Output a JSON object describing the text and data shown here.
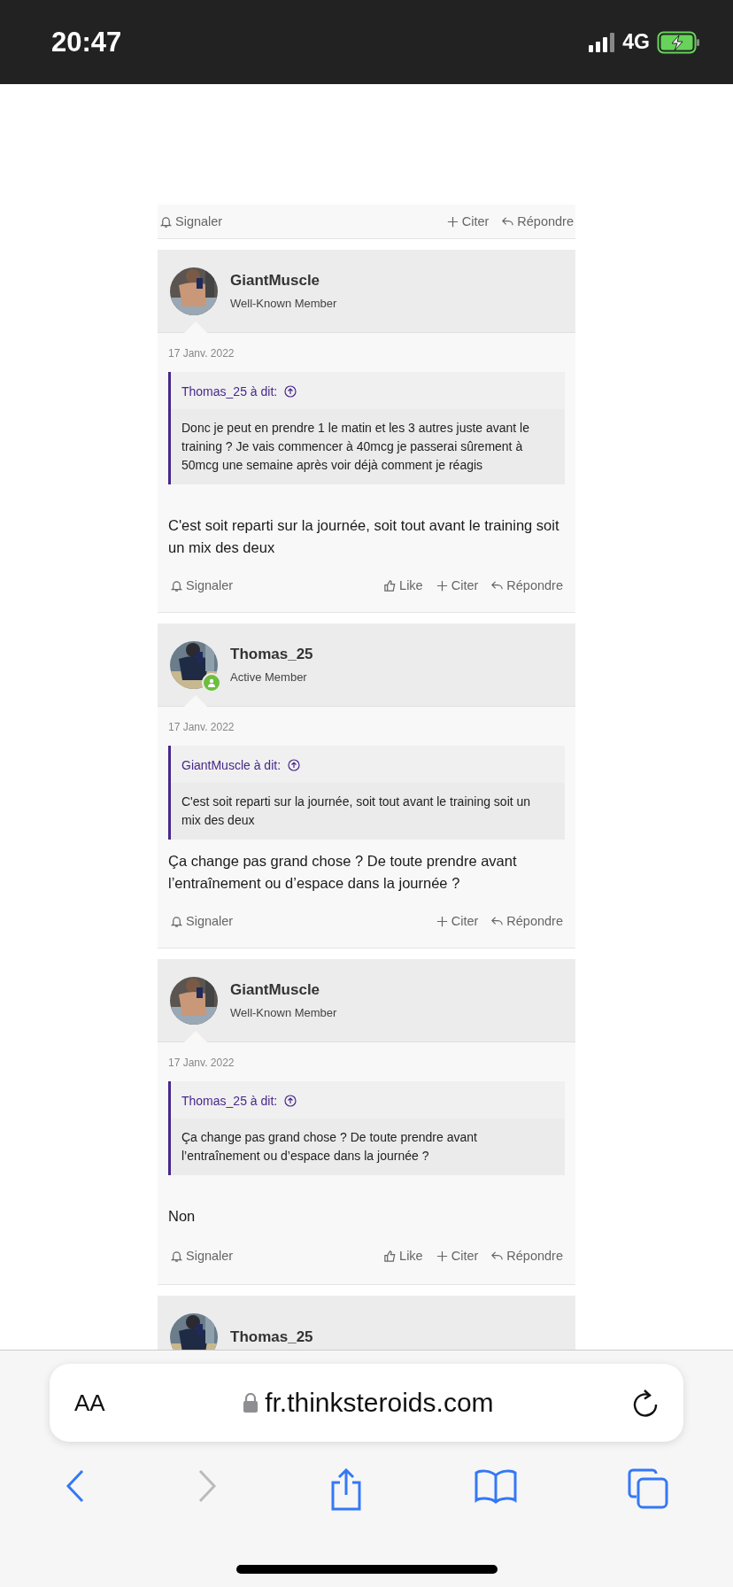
{
  "status_bar": {
    "time": "20:47",
    "network": "4G"
  },
  "previous_footer": {
    "actions": [
      {
        "kind": "report",
        "label": "Signaler"
      },
      {
        "kind": "quote",
        "label": "Citer"
      },
      {
        "kind": "reply",
        "label": "Répondre"
      }
    ]
  },
  "posts": [
    {
      "author": "GiantMuscle",
      "role": "Well-Known Member",
      "online": false,
      "date": "17 Janv. 2022",
      "quote": {
        "author": "Thomas_25 à dit:",
        "text": "Donc je peut en prendre 1 le matin et les 3 autres juste avant le training ? Je vais commencer à 40mcg je passerai sûrement à 50mcg une semaine après voir déjà comment je réagis"
      },
      "message": "C'est soit reparti sur la journée, soit tout avant le training soit un mix des deux",
      "actions": [
        {
          "kind": "report",
          "label": "Signaler"
        },
        {
          "kind": "like",
          "label": "Like"
        },
        {
          "kind": "quote",
          "label": "Citer"
        },
        {
          "kind": "reply",
          "label": "Répondre"
        }
      ]
    },
    {
      "author": "Thomas_25",
      "role": "Active Member",
      "online": true,
      "date": "17 Janv. 2022",
      "quote": {
        "author": "GiantMuscle à dit:",
        "text": "C'est soit reparti sur la journée, soit tout avant le training soit un mix des deux"
      },
      "message": "Ça change pas grand chose ? De toute prendre avant l’entraînement ou d’espace dans la journée ?",
      "actions": [
        {
          "kind": "report",
          "label": "Signaler"
        },
        {
          "kind": "quote",
          "label": "Citer"
        },
        {
          "kind": "reply",
          "label": "Répondre"
        }
      ]
    },
    {
      "author": "GiantMuscle",
      "role": "Well-Known Member",
      "online": false,
      "date": "17 Janv. 2022",
      "quote": {
        "author": "Thomas_25 à dit:",
        "text": "Ça change pas grand chose ? De toute prendre avant l’entraînement ou d’espace dans la journée ?"
      },
      "message": "Non",
      "actions": [
        {
          "kind": "report",
          "label": "Signaler"
        },
        {
          "kind": "like",
          "label": "Like"
        },
        {
          "kind": "quote",
          "label": "Citer"
        },
        {
          "kind": "reply",
          "label": "Répondre"
        }
      ]
    }
  ],
  "next_post": {
    "author": "Thomas_25"
  },
  "browser": {
    "text_size_button": "AA",
    "url": "fr.thinksteroids.com"
  }
}
